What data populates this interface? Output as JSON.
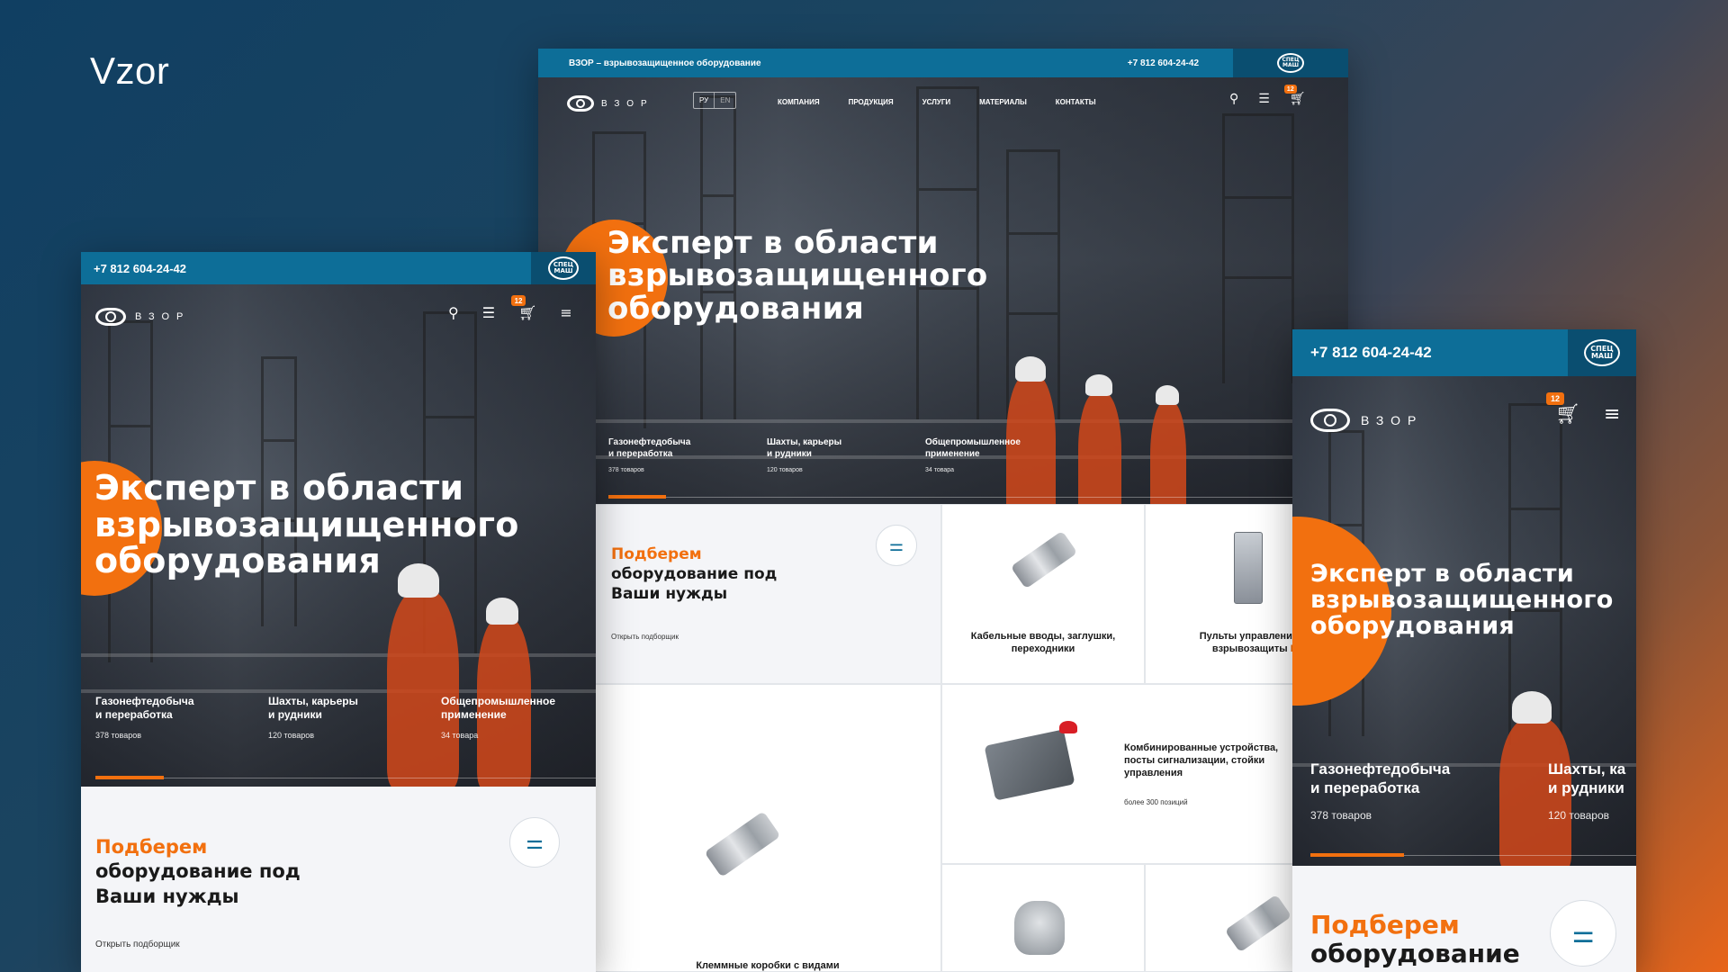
{
  "page": {
    "brand": "Vzor"
  },
  "colors": {
    "accent": "#f2700f",
    "topbar": "#0d6e98",
    "spec": "#0a4e70"
  },
  "common": {
    "phone": "+7 812 604-24-42",
    "spec_logo_top": "СПЕЦ",
    "spec_logo_bottom": "МАШ",
    "logo_text": "ВЗОР",
    "hero_title_line1": "Эксперт в области",
    "hero_title_line2": "взрывозащищенного",
    "hero_title_line3": "оборудования",
    "cart_count": "12",
    "selector_accent": "Подберем",
    "selector_line2": "оборудование под",
    "selector_line3": "Ваши нужды",
    "selector_link": "Открыть подборщик"
  },
  "desktop": {
    "topbar_text": "ВЗОР – взрывозащищенное оборудование",
    "lang": [
      "РУ",
      "EN"
    ],
    "nav": [
      "КОМПАНИЯ",
      "ПРОДУКЦИЯ",
      "УСЛУГИ",
      "МАТЕРИАЛЫ",
      "КОНТАКТЫ"
    ],
    "categories": [
      {
        "name1": "Газонефтедобыча",
        "name2": "и переработка",
        "count": "378 товаров"
      },
      {
        "name1": "Шахты, карьеры",
        "name2": "и рудники",
        "count": "120 товаров"
      },
      {
        "name1": "Общепромышленное",
        "name2": "применение",
        "count": "34 товара"
      }
    ],
    "products": [
      {
        "label1": "Кабельные вводы, заглушки,",
        "label2": "переходники"
      },
      {
        "label1": "Пульты управления с в",
        "label2": "взрывозащиты",
        "label2_accent": "Ex"
      },
      {
        "label1": "Комбинированные устройства,",
        "label2": "посты сигнализации, стойки",
        "label3": "управления",
        "sub": "более 300 позиций"
      },
      {
        "label1": "Клеммные коробки с видами"
      }
    ]
  },
  "tablet": {
    "categories": [
      {
        "name1": "Газонефтедобыча",
        "name2": "и переработка",
        "count": "378 товаров"
      },
      {
        "name1": "Шахты, карьеры",
        "name2": "и рудники",
        "count": "120 товаров"
      },
      {
        "name1": "Общепромышленное",
        "name2": "применение",
        "count": "34 товара"
      }
    ]
  },
  "mobile": {
    "categories": [
      {
        "name1": "Газонефтедобыча",
        "name2": "и переработка",
        "count": "378 товаров"
      },
      {
        "name1": "Шахты, ка",
        "name2": "и рудники",
        "count": "120 товаров"
      }
    ],
    "selector_line2": "оборудование"
  }
}
